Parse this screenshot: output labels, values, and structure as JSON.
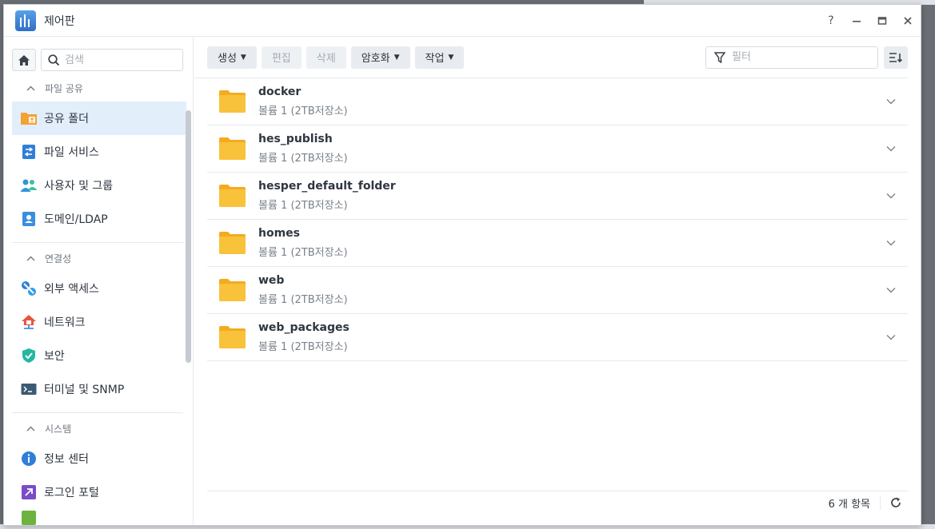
{
  "window": {
    "title": "제어판"
  },
  "sidebar": {
    "search_placeholder": "검색",
    "sections": [
      {
        "title": "파일 공유",
        "items": [
          "공유 폴더",
          "파일 서비스",
          "사용자 및 그룹",
          "도메인/LDAP"
        ]
      },
      {
        "title": "연결성",
        "items": [
          "외부 액세스",
          "네트워크",
          "보안",
          "터미널 및 SNMP"
        ]
      },
      {
        "title": "시스템",
        "items": [
          "정보 센터",
          "로그인 포털"
        ]
      }
    ]
  },
  "toolbar": {
    "create": "생성",
    "edit": "편집",
    "delete": "삭제",
    "encrypt": "암호화",
    "action": "작업",
    "filter_placeholder": "필터"
  },
  "folders": [
    {
      "name": "docker",
      "location": "볼륨 1 (2TB저장소)"
    },
    {
      "name": "hes_publish",
      "location": "볼륨 1 (2TB저장소)"
    },
    {
      "name": "hesper_default_folder",
      "location": "볼륨 1 (2TB저장소)"
    },
    {
      "name": "homes",
      "location": "볼륨 1 (2TB저장소)"
    },
    {
      "name": "web",
      "location": "볼륨 1 (2TB저장소)"
    },
    {
      "name": "web_packages",
      "location": "볼륨 1 (2TB저장소)"
    }
  ],
  "footer": {
    "count": "6 개 항목"
  },
  "colors": {
    "accent": "#e3eefb",
    "folder": "#f8c23a",
    "folder_dark": "#f3ab1f"
  }
}
